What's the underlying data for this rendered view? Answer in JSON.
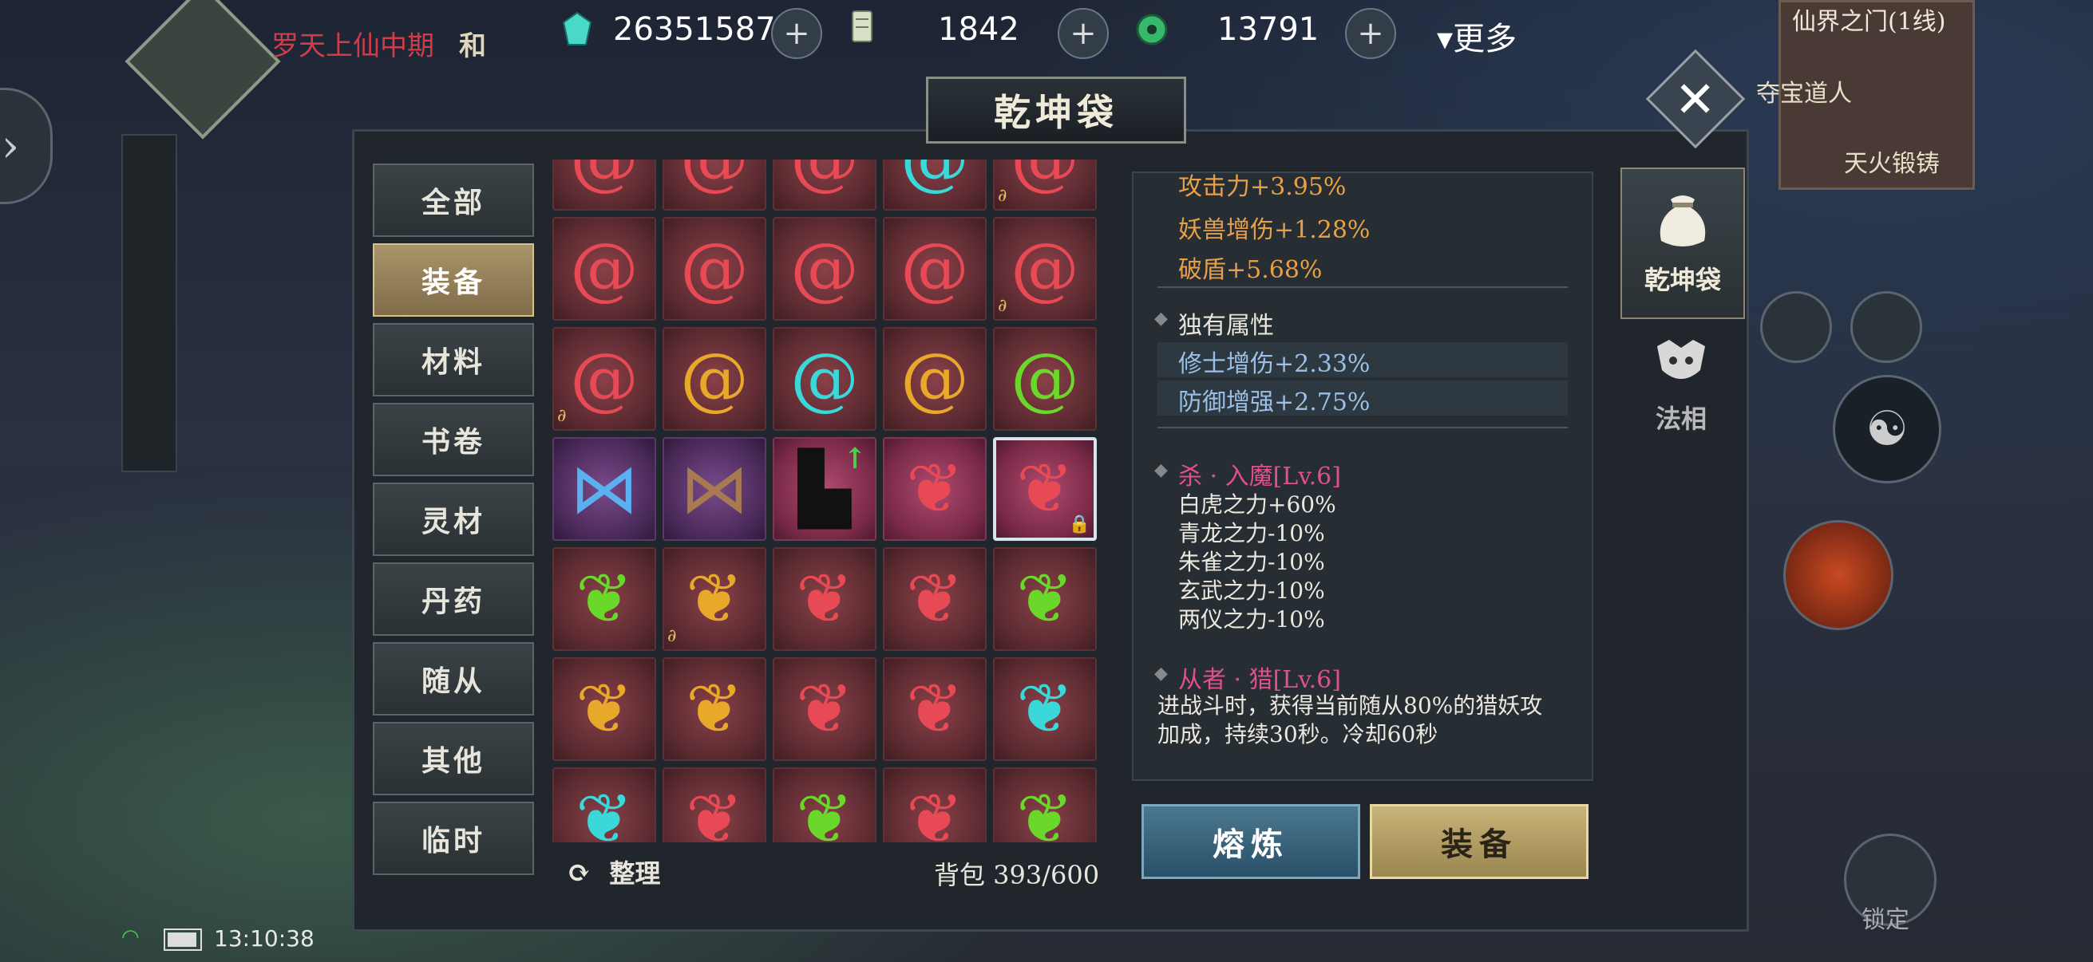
{
  "player": {
    "name": "罗天上仙中期",
    "mode": "和"
  },
  "resources": [
    {
      "icon": "spirit-crystal-icon",
      "value": "26351587"
    },
    {
      "icon": "scroll-token-icon",
      "value": "1842"
    },
    {
      "icon": "jade-coin-icon",
      "value": "13791"
    }
  ],
  "more_label": "更多",
  "minimap": {
    "title": "仙界之门(1线)",
    "npc": "夺宝道人",
    "forge": "天火锻铸"
  },
  "window": {
    "title": "乾坤袋",
    "close": "✕"
  },
  "categories": [
    "全部",
    "装备",
    "材料",
    "书卷",
    "灵材",
    "丹药",
    "随从",
    "其他",
    "临时"
  ],
  "active_category": "装备",
  "grid": {
    "rows": [
      [
        "spiral-red",
        "spiral-red",
        "spiral-red",
        "spiral-cyan",
        "spiral-red"
      ],
      [
        "spiral-red",
        "spiral-red",
        "spiral-red",
        "spiral-red",
        "spiral-red"
      ],
      [
        "spiral-red",
        "spiral-gold",
        "spiral-cyan",
        "spiral-gold",
        "spiral-green"
      ],
      [
        "wings-blue",
        "wings-dark",
        "boots-black",
        "flame-red",
        "flame-red"
      ],
      [
        "flame-green",
        "flame-gold",
        "flame-red",
        "flame-red",
        "flame-green"
      ],
      [
        "flame-gold",
        "flame-gold",
        "flame-red",
        "flame-red",
        "flame-cyan"
      ],
      [
        "flame-cyan",
        "flame-red",
        "flame-green",
        "flame-red",
        "flame-green"
      ]
    ]
  },
  "sort_label": "整理",
  "capacity": "背包 393/600",
  "detail": {
    "stats": [
      "攻击力+3.95%",
      "妖兽增伤+1.28%",
      "破盾+5.68%"
    ],
    "unique_title": "独有属性",
    "unique_stats": [
      "修士增伤+2.33%",
      "防御增强+2.75%"
    ],
    "skill1_title": "杀 · 入魔[Lv.6]",
    "skill1_lines": [
      "白虎之力+60%",
      "青龙之力-10%",
      "朱雀之力-10%",
      "玄武之力-10%",
      "两仪之力-10%"
    ],
    "skill2_title": "从者 · 猎[Lv.6]",
    "skill2_desc": "进战斗时，获得当前随从80%的猎妖攻加成，持续30秒。冷却60秒"
  },
  "actions": {
    "smelt": "熔炼",
    "equip": "装备"
  },
  "side_tabs": [
    {
      "label": "乾坤袋",
      "icon": "pouch-icon"
    },
    {
      "label": "法相",
      "icon": "avatar-mask-icon"
    }
  ],
  "status": {
    "time": "13:10:38"
  },
  "lock_label": "锁定",
  "colors": {
    "accent_gold": "#c8b478",
    "accent_blue": "#4a7890",
    "stat_orange": "#e8a048",
    "skill_pink": "#e0508a"
  }
}
